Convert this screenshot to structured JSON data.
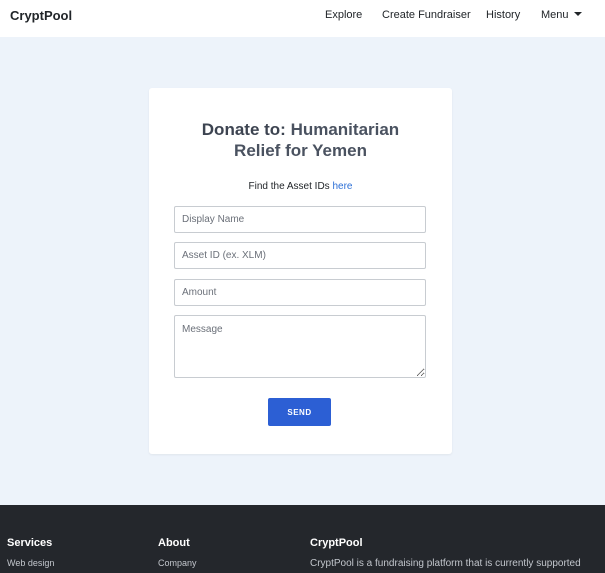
{
  "navbar": {
    "brand": "CryptPool",
    "items": [
      {
        "label": "Explore"
      },
      {
        "label": "Create Fundraiser"
      },
      {
        "label": "History"
      },
      {
        "label": "Menu"
      }
    ]
  },
  "card": {
    "title_prefix": "Donate to:",
    "title_line1": "Humanitarian",
    "title_line2": "Relief for Yemen",
    "hint_text": "Find the Asset IDs ",
    "hint_link": "here",
    "fields": {
      "display_name": {
        "placeholder": "Display Name",
        "value": ""
      },
      "asset_id": {
        "placeholder": "Asset ID (ex. XLM)",
        "value": ""
      },
      "amount": {
        "placeholder": "Amount",
        "value": ""
      },
      "message": {
        "placeholder": "Message",
        "value": ""
      }
    },
    "send_label": "SEND"
  },
  "footer": {
    "services": {
      "title": "Services",
      "link": "Web design"
    },
    "about": {
      "title": "About",
      "link": "Company"
    },
    "cryptpool": {
      "title": "CryptPool",
      "text": "CryptPool is a fundraising platform that is currently supported"
    }
  },
  "colors": {
    "background": "#edf3fa",
    "accent": "#2c5fd4",
    "link": "#2c6fd6",
    "footer": "#24272c"
  }
}
